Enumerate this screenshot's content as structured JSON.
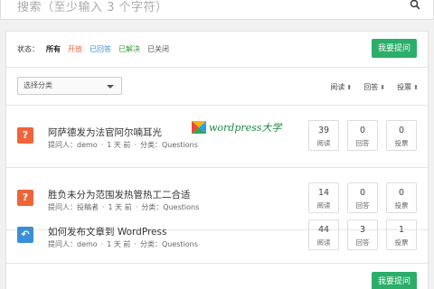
{
  "search": {
    "placeholder": "搜索（至少输入 3 个字符）"
  },
  "status_filter": {
    "label": "状态：",
    "all": "所有",
    "open": "开放",
    "answered": "已回答",
    "solved": "已解决",
    "closed": "已关闭"
  },
  "ask_button": "我要提问",
  "category_select": {
    "value": "选择分类"
  },
  "sort": {
    "views": "阅读",
    "answers": "回答",
    "votes": "投票",
    "arrow": "⬍"
  },
  "watermark": {
    "text": "wordpress大学"
  },
  "questions": [
    {
      "icon": "?",
      "title": "阿萨德发为法官阿尔喃耳光",
      "asker_label": "提问人：",
      "asker": "demo",
      "time": "1 天 前",
      "category_label": "分类：",
      "category": "Questions",
      "views": "39",
      "views_label": "阅读",
      "answers": "0",
      "answers_label": "回答",
      "votes": "0",
      "votes_label": "投票"
    },
    {
      "icon": "?",
      "title": "胜负未分为范围发热管热工二合适",
      "asker_label": "提问人：",
      "asker": "投稿者",
      "time": "1 天 前",
      "category_label": "分类：",
      "category": "Questions",
      "views": "14",
      "views_label": "阅读",
      "answers": "0",
      "answers_label": "回答",
      "votes": "0",
      "votes_label": "投票"
    },
    {
      "icon": "↶",
      "title": "如何发布文章到 WordPress",
      "asker_label": "提问人：",
      "asker": "demo",
      "time": "1 天 前",
      "category_label": "分类：",
      "category": "Questions",
      "views": "44",
      "views_label": "阅读",
      "answers": "3",
      "answers_label": "回答",
      "votes": "1",
      "votes_label": "投票"
    }
  ],
  "colors": {
    "accent": "#2bae69",
    "open": "#f0643a",
    "answered": "#3a8fd6",
    "solved": "#3b9b3b"
  }
}
